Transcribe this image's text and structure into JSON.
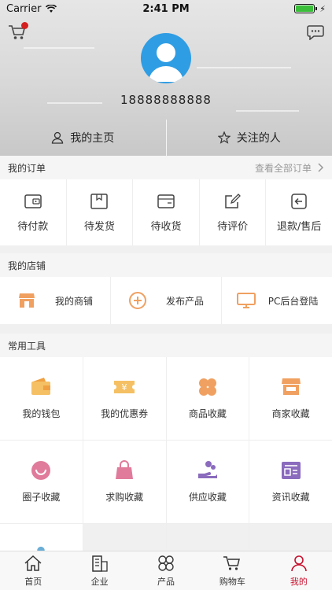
{
  "status": {
    "carrier": "Carrier",
    "time": "2:41 PM"
  },
  "profile": {
    "phone": "18888888888",
    "homepage_label": "我的主页",
    "following_label": "关注的人"
  },
  "orders": {
    "title": "我的订单",
    "view_all": "查看全部订单",
    "items": [
      {
        "label": "待付款",
        "icon": "wallet-icon"
      },
      {
        "label": "待发货",
        "icon": "package-icon"
      },
      {
        "label": "待收货",
        "icon": "receive-box-icon"
      },
      {
        "label": "待评价",
        "icon": "edit-review-icon"
      },
      {
        "label": "退款/售后",
        "icon": "refund-icon"
      }
    ]
  },
  "store": {
    "title": "我的店铺",
    "items": [
      {
        "label": "我的商铺",
        "icon": "shop-icon"
      },
      {
        "label": "发布产品",
        "icon": "add-circle-icon"
      },
      {
        "label": "PC后台登陆",
        "icon": "monitor-icon"
      }
    ]
  },
  "tools": {
    "title": "常用工具",
    "items": [
      {
        "label": "我的钱包",
        "icon": "wallet-icon"
      },
      {
        "label": "我的优惠券",
        "icon": "coupon-icon"
      },
      {
        "label": "商品收藏",
        "icon": "clover-icon"
      },
      {
        "label": "商家收藏",
        "icon": "storefront-icon"
      },
      {
        "label": "圈子收藏",
        "icon": "smile-icon"
      },
      {
        "label": "求购收藏",
        "icon": "shopping-bag-icon"
      },
      {
        "label": "供应收藏",
        "icon": "hand-supply-icon"
      },
      {
        "label": "资讯收藏",
        "icon": "news-icon"
      }
    ]
  },
  "tabbar": {
    "items": [
      {
        "label": "首页",
        "icon": "home-icon"
      },
      {
        "label": "企业",
        "icon": "building-icon"
      },
      {
        "label": "产品",
        "icon": "products-icon"
      },
      {
        "label": "购物车",
        "icon": "cart-icon"
      },
      {
        "label": "我的",
        "icon": "user-icon"
      }
    ],
    "active_index": 4
  },
  "colors": {
    "accent": "#c8102e",
    "avatar_bg": "#2f9de4",
    "icon_orange": "#f0a060",
    "icon_pink": "#e07b9b",
    "icon_purple": "#8a6bbd"
  }
}
